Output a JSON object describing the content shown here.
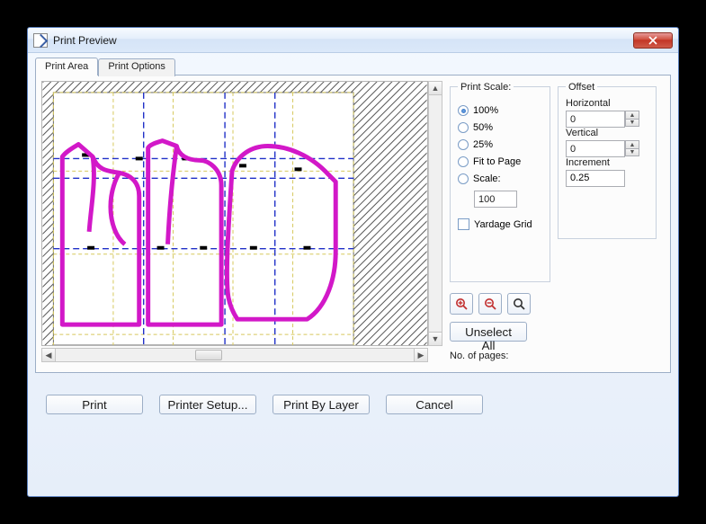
{
  "window": {
    "title": "Print Preview"
  },
  "tabs": {
    "area": "Print Area",
    "options": "Print Options"
  },
  "scale": {
    "legend": "Print Scale:",
    "opt100": "100%",
    "opt50": "50%",
    "opt25": "25%",
    "fit": "Fit to Page",
    "scale": "Scale:",
    "scale_value": "100",
    "yardage": "Yardage Grid"
  },
  "offset": {
    "legend": "Offset",
    "horizontal": "Horizontal",
    "h_value": "0",
    "vertical": "Vertical",
    "v_value": "0",
    "increment": "Increment",
    "inc_value": "0.25"
  },
  "buttons": {
    "unselect": "Unselect All",
    "nopages": "No. of pages:",
    "print": "Print",
    "printer_setup": "Printer Setup...",
    "print_by_layer": "Print By Layer",
    "cancel": "Cancel"
  }
}
